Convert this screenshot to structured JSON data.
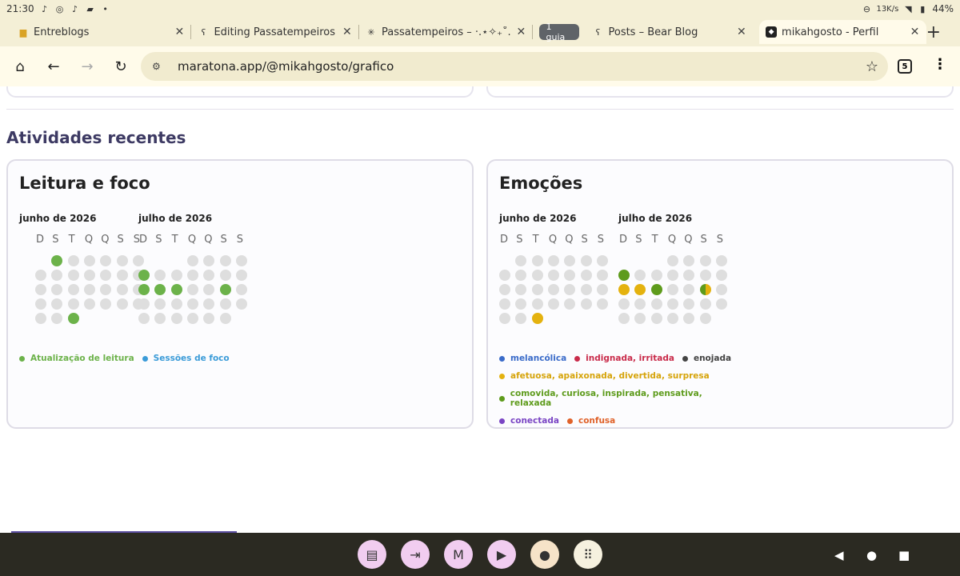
{
  "status_bar": {
    "time": "21:30",
    "net_speed": "13K/s",
    "battery": "44%"
  },
  "tabs": [
    {
      "title": "Entreblogs",
      "favicon": "folder-icon"
    },
    {
      "title": "Editing Passatempeiros – B",
      "favicon": "bear-icon"
    },
    {
      "title": "Passatempeiros – ·.⋆✧₊˚. Do",
      "favicon": "sparkle-icon"
    },
    {
      "group_label": "1 guia"
    },
    {
      "title": "Posts – Bear Blog",
      "favicon": "bear-icon"
    },
    {
      "title": "mikahgosto - Perfil",
      "favicon": "cat-icon",
      "active": true
    }
  ],
  "toolbar": {
    "url": "maratona.app/@mikahgosto/grafico",
    "tab_count": "5"
  },
  "page": {
    "section_title": "Atividades recentes",
    "weekdays": [
      "D",
      "S",
      "T",
      "Q",
      "Q",
      "S",
      "S"
    ],
    "months": [
      "junho de 2026",
      "julho de 2026"
    ],
    "reading": {
      "title": "Leitura e foco",
      "legend": [
        {
          "label": "Atualização de leitura",
          "color": "#6cb24a"
        },
        {
          "label": "Sessões de foco",
          "color": "#3a9bd8"
        }
      ]
    },
    "emotions": {
      "title": "Emoções",
      "legend_rows": [
        [
          {
            "label": "melancólica",
            "color": "#3a6bc9"
          },
          {
            "label": "indignada, irritada",
            "color": "#c92b4a"
          },
          {
            "label": "enojada",
            "color": "#444444"
          }
        ],
        [
          {
            "label": "afetuosa, apaixonada, divertida, surpresa",
            "color": "#e4b20f"
          }
        ],
        [
          {
            "label": "comovida, curiosa, inspirada, pensativa, relaxada",
            "color": "#5e9b1c"
          }
        ],
        [
          {
            "label": "conectada",
            "color": "#7a45c4"
          },
          {
            "label": "confusa",
            "color": "#e0622a"
          }
        ]
      ]
    }
  },
  "calendar_colors": {
    "empty": "#dedede",
    "reading": "#6cb24a",
    "yellow": "#e4b20f",
    "green": "#5e9b1c"
  },
  "navbar": {
    "apps": [
      "docs-icon",
      "screen-icon",
      "mail-icon",
      "player-icon",
      "tomato-icon",
      "apps-grid-icon"
    ]
  }
}
